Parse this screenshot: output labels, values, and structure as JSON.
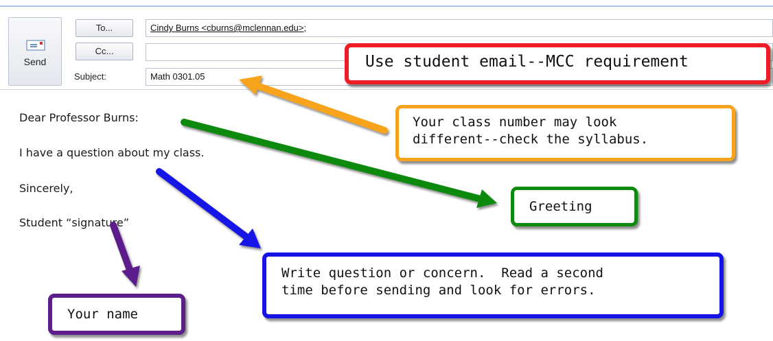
{
  "compose": {
    "send_label": "Send",
    "to_button": "To...",
    "cc_button": "Cc...",
    "subject_label": "Subject:",
    "to_value": "Cindy Burns <cburns@mclennan.edu>",
    "to_suffix": ";",
    "cc_value": "",
    "subject_value": "Math 0301.05"
  },
  "message_body": [
    "Dear Professor Burns:",
    "I have a question about my class.",
    "Sincerely,",
    "Student “signature”"
  ],
  "callouts": {
    "email": "Use student email--MCC requirement",
    "class_number_line1": "Your class number may look",
    "class_number_line2": "different--check the syllabus.",
    "greeting": "Greeting",
    "question_line1": "Write question or concern.  Read a second",
    "question_line2": "time before sending and look for errors.",
    "name": "Your name"
  },
  "colors": {
    "red": "#ee1c24",
    "orange": "#f7a31c",
    "green": "#0e8a0e",
    "blue": "#1414e6",
    "purple": "#5b1e8b"
  }
}
